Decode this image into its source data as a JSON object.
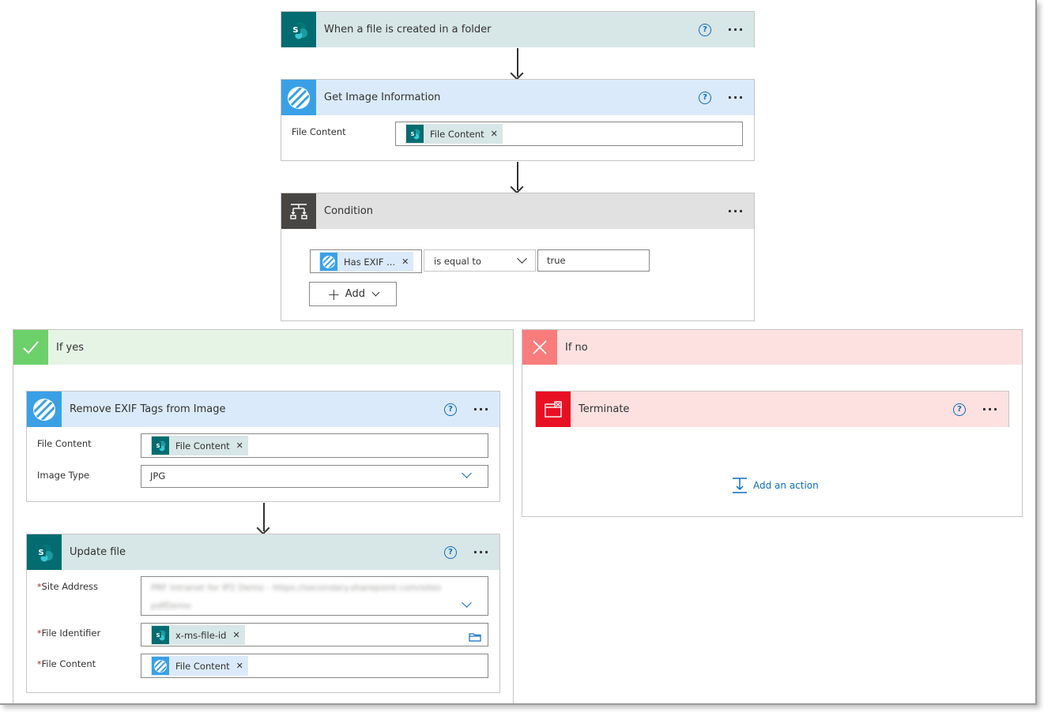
{
  "trigger": {
    "title": "When a file is created in a folder",
    "help_icon": "?",
    "more_icon": "···"
  },
  "get_image": {
    "title": "Get Image Information",
    "help_icon": "?",
    "more_icon": "···",
    "file_content_label": "File Content",
    "file_content_token": "File Content"
  },
  "condition": {
    "title": "Condition",
    "more_icon": "···",
    "left_token": "Has EXIF ...",
    "operator": "is equal to",
    "value": "true",
    "add_label": "Add"
  },
  "if_yes": {
    "title": "If yes",
    "remove_exif": {
      "title": "Remove EXIF Tags from Image",
      "help_icon": "?",
      "more_icon": "···",
      "file_content_label": "File Content",
      "file_content_token": "File Content",
      "image_type_label": "Image Type",
      "image_type_value": "JPG"
    },
    "update_file": {
      "title": "Update file",
      "help_icon": "?",
      "more_icon": "···",
      "required_mark": "*",
      "site_address_label": "Site Address",
      "site_address_value_line1": "PRF Intranet for IP2 Demo - https://secondary.sharepoint.com/sites",
      "site_address_value_line2": "pdfDemo",
      "file_identifier_label": "File Identifier",
      "file_identifier_token": "x-ms-file-id",
      "file_content_label": "File Content",
      "file_content_token": "File Content"
    }
  },
  "if_no": {
    "title": "If no",
    "terminate": {
      "title": "Terminate",
      "help_icon": "?",
      "more_icon": "···"
    },
    "add_action_label": "Add an action"
  },
  "colors": {
    "sharepoint": "#036c70",
    "plumsail_blue": "#3aa0e6",
    "condition_gray": "#484644",
    "yes_green": "#6cd06b",
    "no_red": "#f87c7c",
    "terminate_red": "#e81123",
    "link_blue": "#0f6cbd"
  },
  "icons": {
    "sharepoint": "sharepoint-icon",
    "plumsail": "plumsail-stripes-icon",
    "condition": "condition-icon",
    "check": "check-icon",
    "close": "close-icon",
    "terminate": "terminate-icon",
    "add_action": "add-action-icon",
    "folder": "folder-icon"
  }
}
